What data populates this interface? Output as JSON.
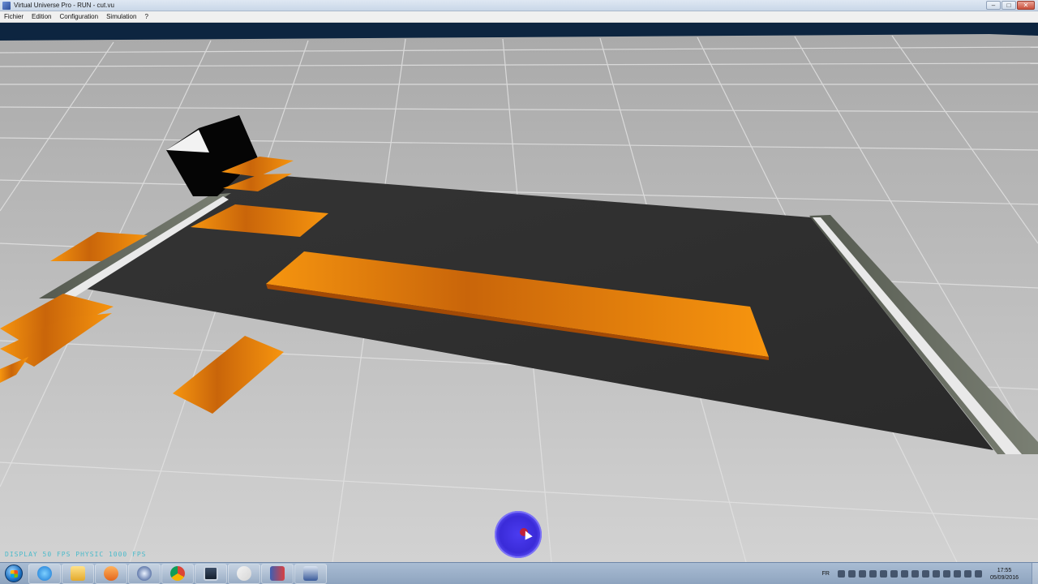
{
  "window": {
    "title": "Virtual Universe Pro - RUN - cut.vu",
    "controls": {
      "minimize": "–",
      "maximize": "□",
      "close": "✕"
    }
  },
  "menu": {
    "items": [
      "Fichier",
      "Edition",
      "Configuration",
      "Simulation",
      "?"
    ]
  },
  "viewport": {
    "status_text": "DISPLAY 50 FPS  PHYSIC 1000 FPS",
    "colors": {
      "floor": "#bdbdbd",
      "sky": "#0d2540",
      "conveyor": "#2f2f2f",
      "part": "#f08a0c",
      "cutter": "#050505"
    }
  },
  "taskbar": {
    "apps": [
      {
        "name": "Internet Explorer",
        "icon": "ie-icon"
      },
      {
        "name": "Explorateur",
        "icon": "folder-icon"
      },
      {
        "name": "Lecteur multimédia",
        "icon": "media-player-icon"
      },
      {
        "name": "Thunderbird",
        "icon": "mail-bird-icon"
      },
      {
        "name": "Google Chrome",
        "icon": "chrome-icon"
      },
      {
        "name": "Moniteur",
        "icon": "monitor-icon"
      },
      {
        "name": "Paint",
        "icon": "paint-icon"
      },
      {
        "name": "Manuel",
        "icon": "book-icon"
      },
      {
        "name": "Virtual Universe Pro",
        "icon": "vu-icon"
      }
    ],
    "tray": {
      "language": "FR",
      "time": "17:55",
      "date": "05/09/2016"
    }
  }
}
